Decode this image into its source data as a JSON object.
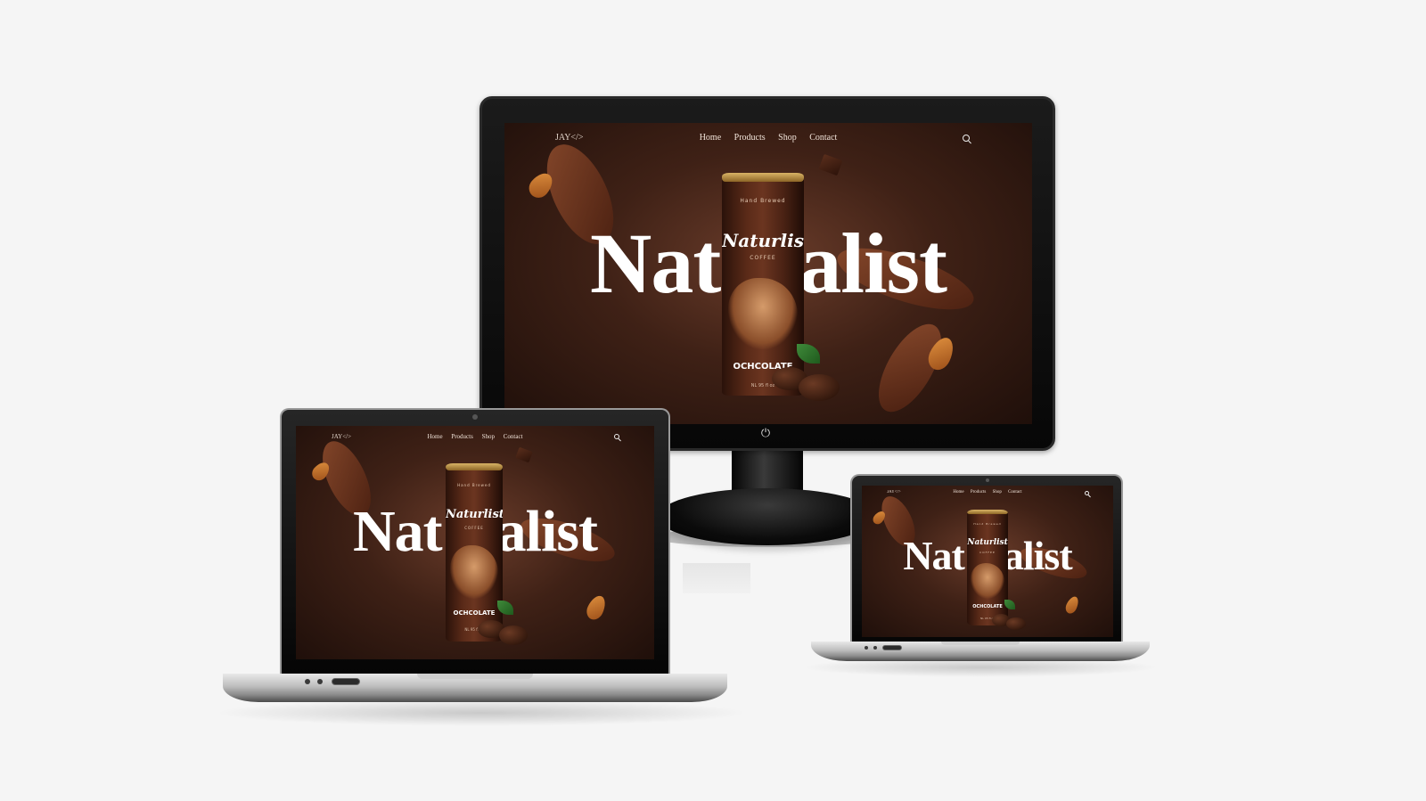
{
  "site": {
    "logo": "JAY</>",
    "nav_items": [
      "Home",
      "Products",
      "Shop",
      "Contact"
    ],
    "hero_left": "Nat",
    "hero_right": "alist",
    "can": {
      "brand": "Naturlist",
      "sub": "COFFEE",
      "top_text": "Hand Brewed",
      "flavor": "OCHCOLATE",
      "volume": "NL 95 fl oz"
    }
  },
  "colors": {
    "background": "#f5f5f5",
    "screen_dark": "#1f0f0a",
    "screen_glow": "#6a3c2a",
    "hero_text": "#ffffff"
  },
  "icons": [
    "search-icon",
    "power-icon"
  ]
}
